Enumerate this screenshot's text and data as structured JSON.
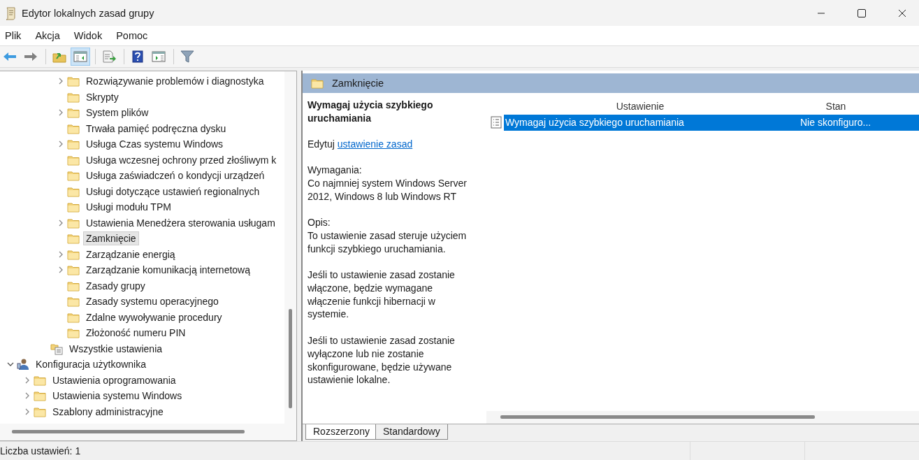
{
  "window": {
    "title": "Edytor lokalnych zasad grupy"
  },
  "menu": [
    "Plik",
    "Akcja",
    "Widok",
    "Pomoc"
  ],
  "toolbar": [
    {
      "kind": "back",
      "pressed": false
    },
    {
      "kind": "forward",
      "pressed": false
    },
    {
      "kind": "sep"
    },
    {
      "kind": "up",
      "pressed": false
    },
    {
      "kind": "tree",
      "pressed": true
    },
    {
      "kind": "sep"
    },
    {
      "kind": "export",
      "pressed": false
    },
    {
      "kind": "sep"
    },
    {
      "kind": "help",
      "pressed": false
    },
    {
      "kind": "actions",
      "pressed": false
    },
    {
      "kind": "sep"
    },
    {
      "kind": "filter",
      "pressed": false
    }
  ],
  "tree": [
    {
      "children": [
        {
          "children": [
            {
              "children": [
                {
                  "label": "Rozwiązywanie problemów i diagnostyka",
                  "kind": "folder",
                  "has_children": true,
                  "expanded": false,
                  "selected": false
                },
                {
                  "label": "Skrypty",
                  "kind": "folder",
                  "has_children": false,
                  "selected": false
                },
                {
                  "label": "System plików",
                  "kind": "folder",
                  "has_children": true,
                  "expanded": false,
                  "selected": false
                },
                {
                  "label": "Trwała pamięć podręczna dysku",
                  "kind": "folder",
                  "has_children": false,
                  "selected": false
                },
                {
                  "label": "Usługa Czas systemu Windows",
                  "kind": "folder",
                  "has_children": true,
                  "expanded": false,
                  "selected": false
                },
                {
                  "label": "Usługa wczesnej ochrony przed złośliwym k",
                  "kind": "folder",
                  "has_children": false,
                  "selected": false
                },
                {
                  "label": "Usługa zaświadczeń o kondycji urządzeń",
                  "kind": "folder",
                  "has_children": false,
                  "selected": false
                },
                {
                  "label": "Usługi dotyczące ustawień regionalnych",
                  "kind": "folder",
                  "has_children": false,
                  "selected": false
                },
                {
                  "label": "Usługi modułu TPM",
                  "kind": "folder",
                  "has_children": false,
                  "selected": false
                },
                {
                  "label": "Ustawienia Menedżera sterowania usługam",
                  "kind": "folder",
                  "has_children": true,
                  "expanded": false,
                  "selected": false
                },
                {
                  "label": "Zamknięcie",
                  "kind": "folder",
                  "has_children": false,
                  "selected": true
                },
                {
                  "label": "Zarządzanie energią",
                  "kind": "folder",
                  "has_children": true,
                  "expanded": false,
                  "selected": false
                },
                {
                  "label": "Zarządzanie komunikacją internetową",
                  "kind": "folder",
                  "has_children": true,
                  "expanded": false,
                  "selected": false
                },
                {
                  "label": "Zasady grupy",
                  "kind": "folder",
                  "has_children": false,
                  "selected": false
                },
                {
                  "label": "Zasady systemu operacyjnego",
                  "kind": "folder",
                  "has_children": false,
                  "selected": false
                },
                {
                  "label": "Zdalne wywoływanie procedury",
                  "kind": "folder",
                  "has_children": false,
                  "selected": false
                },
                {
                  "label": "Złożoność numeru PIN",
                  "kind": "folder",
                  "has_children": false,
                  "selected": false
                }
              ]
            },
            {
              "label": "Wszystkie ustawienia",
              "kind": "settings",
              "has_children": false,
              "selected": false
            }
          ]
        }
      ]
    },
    {
      "label": "Konfiguracja użytkownika",
      "kind": "user",
      "has_children": true,
      "expanded": true,
      "selected": false,
      "children": [
        {
          "label": "Ustawienia oprogramowania",
          "kind": "folder",
          "has_children": true,
          "expanded": false,
          "selected": false
        },
        {
          "label": "Ustawienia systemu Windows",
          "kind": "folder",
          "has_children": true,
          "expanded": false,
          "selected": false
        },
        {
          "label": "Szablony administracyjne",
          "kind": "folder",
          "has_children": true,
          "expanded": false,
          "selected": false
        }
      ]
    }
  ],
  "header": {
    "title": "Zamknięcie"
  },
  "description": {
    "title": "Wymagaj użycia szybkiego uruchamiania",
    "edit_prefix": "Edytuj",
    "edit_link": "ustawienie zasad",
    "requirements_label": "Wymagania:",
    "requirements": "Co najmniej system Windows Server 2012, Windows 8 lub Windows RT",
    "description_label": "Opis:",
    "paragraphs": [
      "To ustawienie zasad steruje użyciem funkcji szybkiego uruchamiania.",
      "Jeśli to ustawienie zasad zostanie włączone, będzie wymagane włączenie funkcji hibernacji w systemie.",
      "Jeśli to ustawienie zasad zostanie wyłączone lub nie zostanie skonfigurowane, będzie używane ustawienie lokalne."
    ]
  },
  "table": {
    "columns": [
      "Ustawienie",
      "Stan"
    ],
    "rows": [
      {
        "setting": "Wymagaj użycia szybkiego uruchamiania",
        "state": "Nie skonfiguro...",
        "selected": true
      }
    ]
  },
  "view_tabs": [
    {
      "label": "Rozszerzony",
      "selected": true
    },
    {
      "label": "Standardowy",
      "selected": false
    }
  ],
  "status_bar": "Liczba ustawień: 1"
}
